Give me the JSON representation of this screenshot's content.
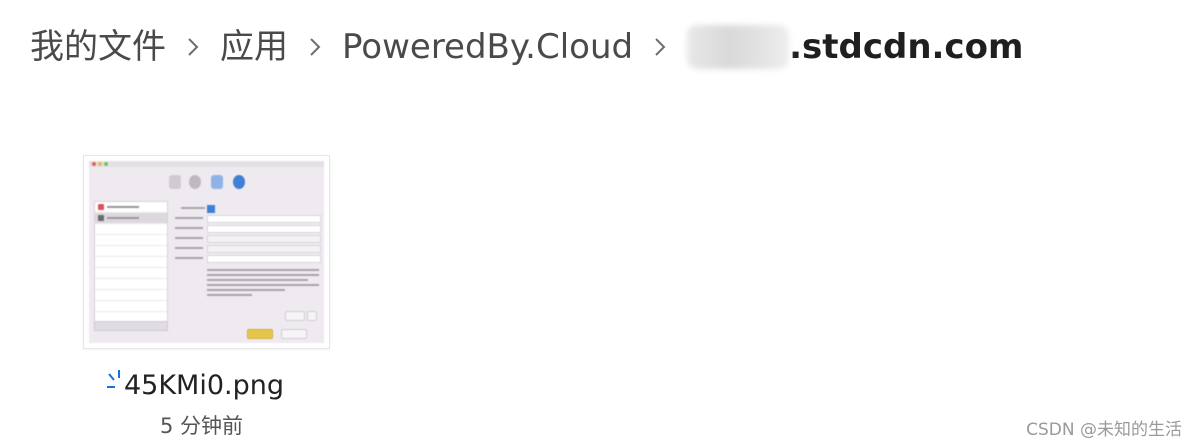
{
  "breadcrumb": {
    "items": [
      "我的文件",
      "应用",
      "PoweredBy.Cloud"
    ],
    "current_visible": ".stdcdn.com",
    "separator_icon": "chevron-right-icon"
  },
  "file": {
    "name": "45KMi0.png",
    "modified": "5 分钟前",
    "status_icon": "syncing-icon",
    "accent_color": "#1a6fd8"
  },
  "watermark": "CSDN @未知的生活"
}
